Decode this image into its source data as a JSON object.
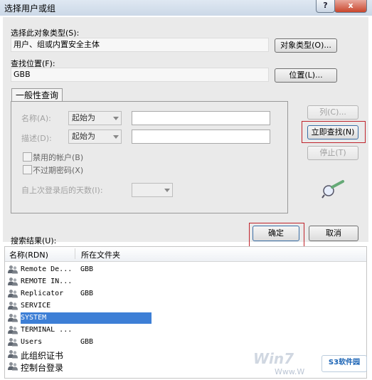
{
  "window": {
    "title": "选择用户或组",
    "help_label": "?",
    "close_label": "x"
  },
  "object_type": {
    "label": "选择此对象类型(S):",
    "value": "用户、组或内置安全主体",
    "button": "对象类型(O)..."
  },
  "location": {
    "label": "查找位置(F):",
    "value": "GBB",
    "button": "位置(L)..."
  },
  "tab": {
    "label": "一般性查询"
  },
  "query": {
    "name_label": "名称(A):",
    "name_mode": "起始为",
    "desc_label": "描述(D):",
    "desc_mode": "起始为",
    "disabled_accounts": "禁用的帐户(B)",
    "non_expiring_pw": "不过期密码(X)",
    "days_since_logon": "自上次登录后的天数(I):"
  },
  "side_buttons": {
    "columns": "列(C)...",
    "find_now": "立即查找(N)",
    "stop": "停止(T)"
  },
  "dialog_buttons": {
    "ok": "确定",
    "cancel": "取消"
  },
  "results": {
    "label": "搜索结果(U):",
    "columns": [
      "名称(RDN)",
      "所在文件夹"
    ],
    "rows": [
      {
        "name": "Remote De...",
        "folder": "GBB"
      },
      {
        "name": "REMOTE IN...",
        "folder": ""
      },
      {
        "name": "Replicator",
        "folder": "GBB"
      },
      {
        "name": "SERVICE",
        "folder": ""
      },
      {
        "name": "SYSTEM",
        "folder": "",
        "selected": true
      },
      {
        "name": "TERMINAL ...",
        "folder": ""
      },
      {
        "name": "Users",
        "folder": "GBB"
      },
      {
        "name": "此组织证书",
        "folder": ""
      },
      {
        "name": "控制台登录",
        "folder": ""
      }
    ]
  },
  "watermark": {
    "brand_left": "Win7",
    "brand_left_url": "Www.W",
    "brand_right": "S3软件园"
  },
  "colors": {
    "highlight_border": "#c0232b",
    "selection": "#3d7fd6"
  }
}
